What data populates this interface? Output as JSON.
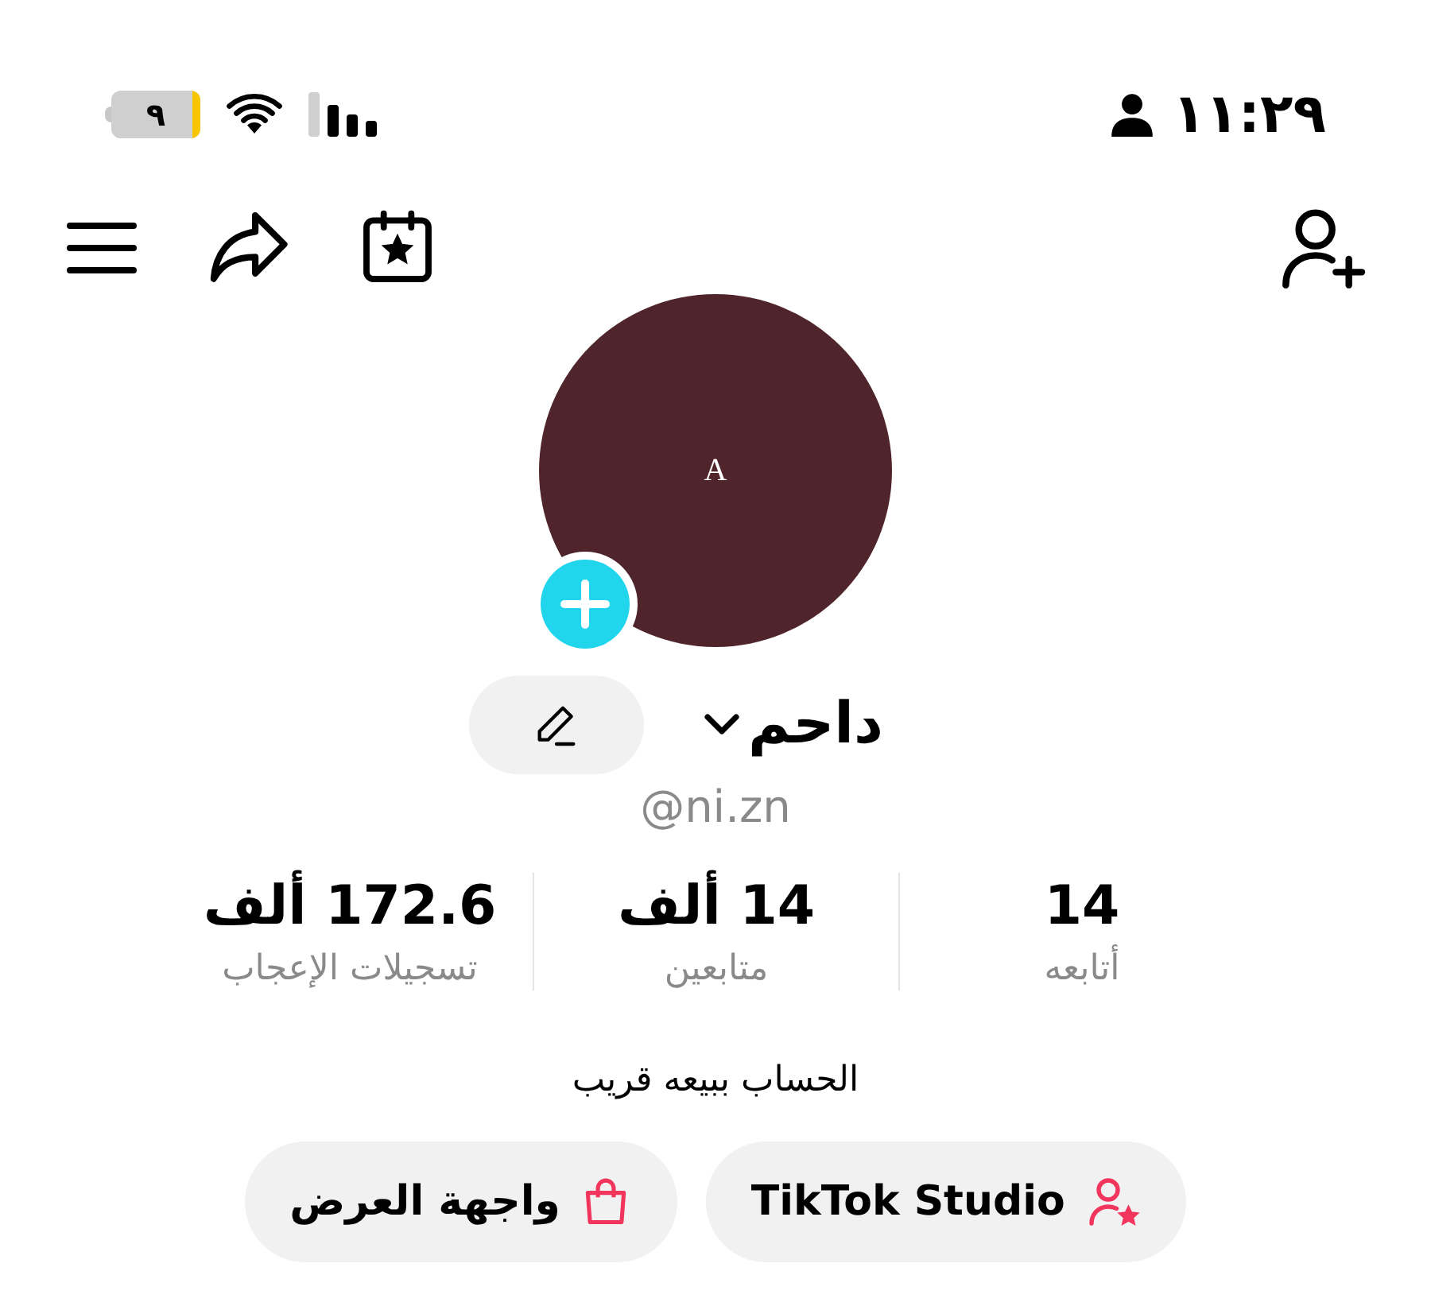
{
  "status_bar": {
    "time": "١١:٢٩",
    "battery": "٩"
  },
  "profile": {
    "avatar_letter": "A",
    "name": "داحم",
    "handle": "@ni.zn",
    "bio": "الحساب ببيعه قريب"
  },
  "stats": [
    {
      "value": "14",
      "label": "أتابعه"
    },
    {
      "value": "14 ألف",
      "label": "متابعين"
    },
    {
      "value": "172.6 ألف",
      "label": "تسجيلات الإعجاب"
    }
  ],
  "buttons": [
    {
      "kind": "studio",
      "label": "TikTok Studio"
    },
    {
      "kind": "showcase",
      "label": "واجهة العرض"
    }
  ]
}
